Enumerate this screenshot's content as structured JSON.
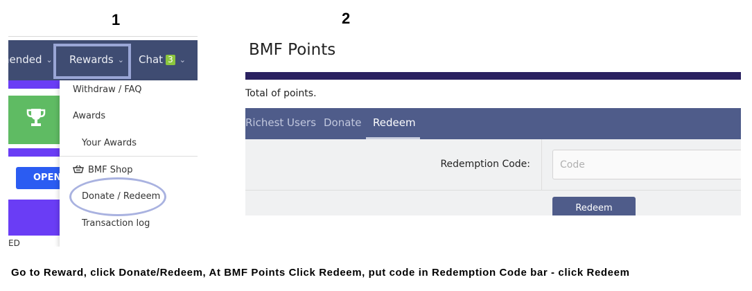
{
  "steps": {
    "one": "1",
    "two": "2"
  },
  "panel1": {
    "nav": {
      "recommended_label": "nended",
      "rewards_label": "Rewards",
      "chat_label": "Chat",
      "chat_badge": "3"
    },
    "open_button_label": "OPEN",
    "partial_text": "ED",
    "dropdown": {
      "withdraw": "Withdraw / FAQ",
      "awards": "Awards",
      "your_awards": "Your Awards",
      "shop": "BMF Shop",
      "donate_redeem": "Donate / Redeem",
      "transaction_log": "Transaction log"
    },
    "colors": {
      "nav_bg": "#3f4c72",
      "highlight": "#9aa6d6",
      "badge": "#8cc63e",
      "green_card": "#5fbb63",
      "purple": "#6a3df5",
      "open_button": "#2b5cf2"
    },
    "icons": {
      "trophy": "trophy-icon",
      "cart": "basket-icon",
      "chevron": "chevron-down-icon"
    }
  },
  "panel2": {
    "title": "BMF Points",
    "subtitle": "Total of points.",
    "tabs": [
      "Richest Users",
      "Donate",
      "Redeem"
    ],
    "active_tab": "Redeem",
    "form": {
      "label": "Redemption Code:",
      "input_value": "",
      "input_placeholder": "Code",
      "button_label": "Redeem"
    },
    "colors": {
      "header_bar": "#2a2160",
      "tabs_bg": "#4f5c8a",
      "form_bg": "#f0f1f2"
    }
  },
  "instruction": "Go to Reward, click Donate/Redeem, At BMF Points Click Redeem, put code in Redemption Code bar - click Redeem"
}
